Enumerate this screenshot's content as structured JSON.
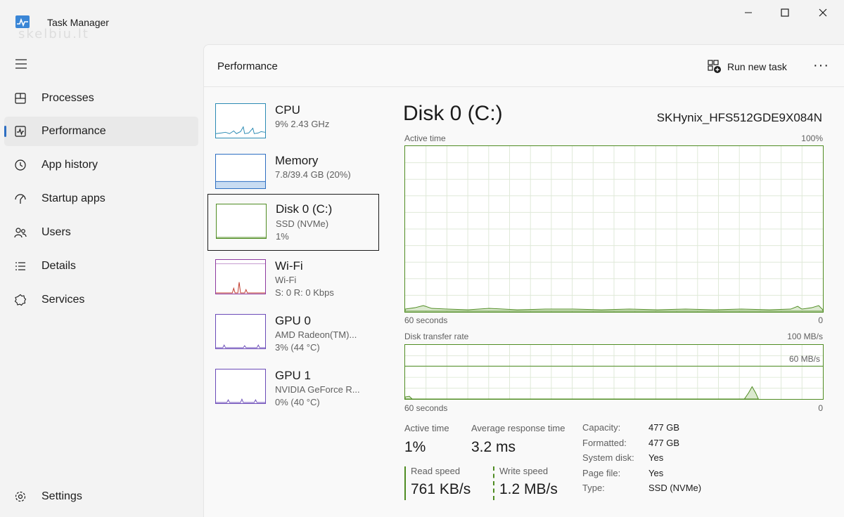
{
  "window": {
    "title": "Task Manager",
    "watermark": "skelbiu.lt"
  },
  "sidebar": {
    "items": [
      {
        "label": "Processes",
        "icon": "processes-icon"
      },
      {
        "label": "Performance",
        "icon": "performance-icon",
        "active": true
      },
      {
        "label": "App history",
        "icon": "app-history-icon"
      },
      {
        "label": "Startup apps",
        "icon": "startup-apps-icon"
      },
      {
        "label": "Users",
        "icon": "users-icon"
      },
      {
        "label": "Details",
        "icon": "details-icon"
      },
      {
        "label": "Services",
        "icon": "services-icon"
      }
    ],
    "settings_label": "Settings"
  },
  "header": {
    "title": "Performance",
    "run_new_task": "Run new task"
  },
  "resources": [
    {
      "name": "CPU",
      "line1": "9% 2.43 GHz",
      "line2": ""
    },
    {
      "name": "Memory",
      "line1": "7.8/39.4 GB (20%)",
      "line2": ""
    },
    {
      "name": "Disk 0 (C:)",
      "line1": "SSD (NVMe)",
      "line2": "1%"
    },
    {
      "name": "Wi-Fi",
      "line1": "Wi-Fi",
      "line2": "S: 0 R: 0 Kbps"
    },
    {
      "name": "GPU 0",
      "line1": "AMD Radeon(TM)...",
      "line2": "3% (44 °C)"
    },
    {
      "name": "GPU 1",
      "line1": "NVIDIA GeForce R...",
      "line2": "0% (40 °C)"
    }
  ],
  "detail": {
    "title": "Disk 0 (C:)",
    "model": "SKHynix_HFS512GDE9X084N",
    "graph1": {
      "label": "Active time",
      "max": "100%",
      "time": "60 seconds",
      "min": "0"
    },
    "graph2": {
      "label": "Disk transfer rate",
      "max": "100 MB/s",
      "line_label": "60 MB/s",
      "time": "60 seconds",
      "min": "0"
    },
    "stats": {
      "active_time_label": "Active time",
      "active_time_value": "1%",
      "avg_response_label": "Average response time",
      "avg_response_value": "3.2 ms",
      "read_speed_label": "Read speed",
      "read_speed_value": "761 KB/s",
      "write_speed_label": "Write speed",
      "write_speed_value": "1.2 MB/s"
    },
    "properties": [
      {
        "key": "Capacity:",
        "value": "477 GB"
      },
      {
        "key": "Formatted:",
        "value": "477 GB"
      },
      {
        "key": "System disk:",
        "value": "Yes"
      },
      {
        "key": "Page file:",
        "value": "Yes"
      },
      {
        "key": "Type:",
        "value": "SSD (NVMe)"
      }
    ]
  },
  "colors": {
    "cpu": "#2b8bb4",
    "memory": "#2e6fc2",
    "disk": "#4f8c22",
    "wifi": "#8e3aa0",
    "gpu": "#6b4bb8",
    "accent": "#2e6fc2"
  }
}
